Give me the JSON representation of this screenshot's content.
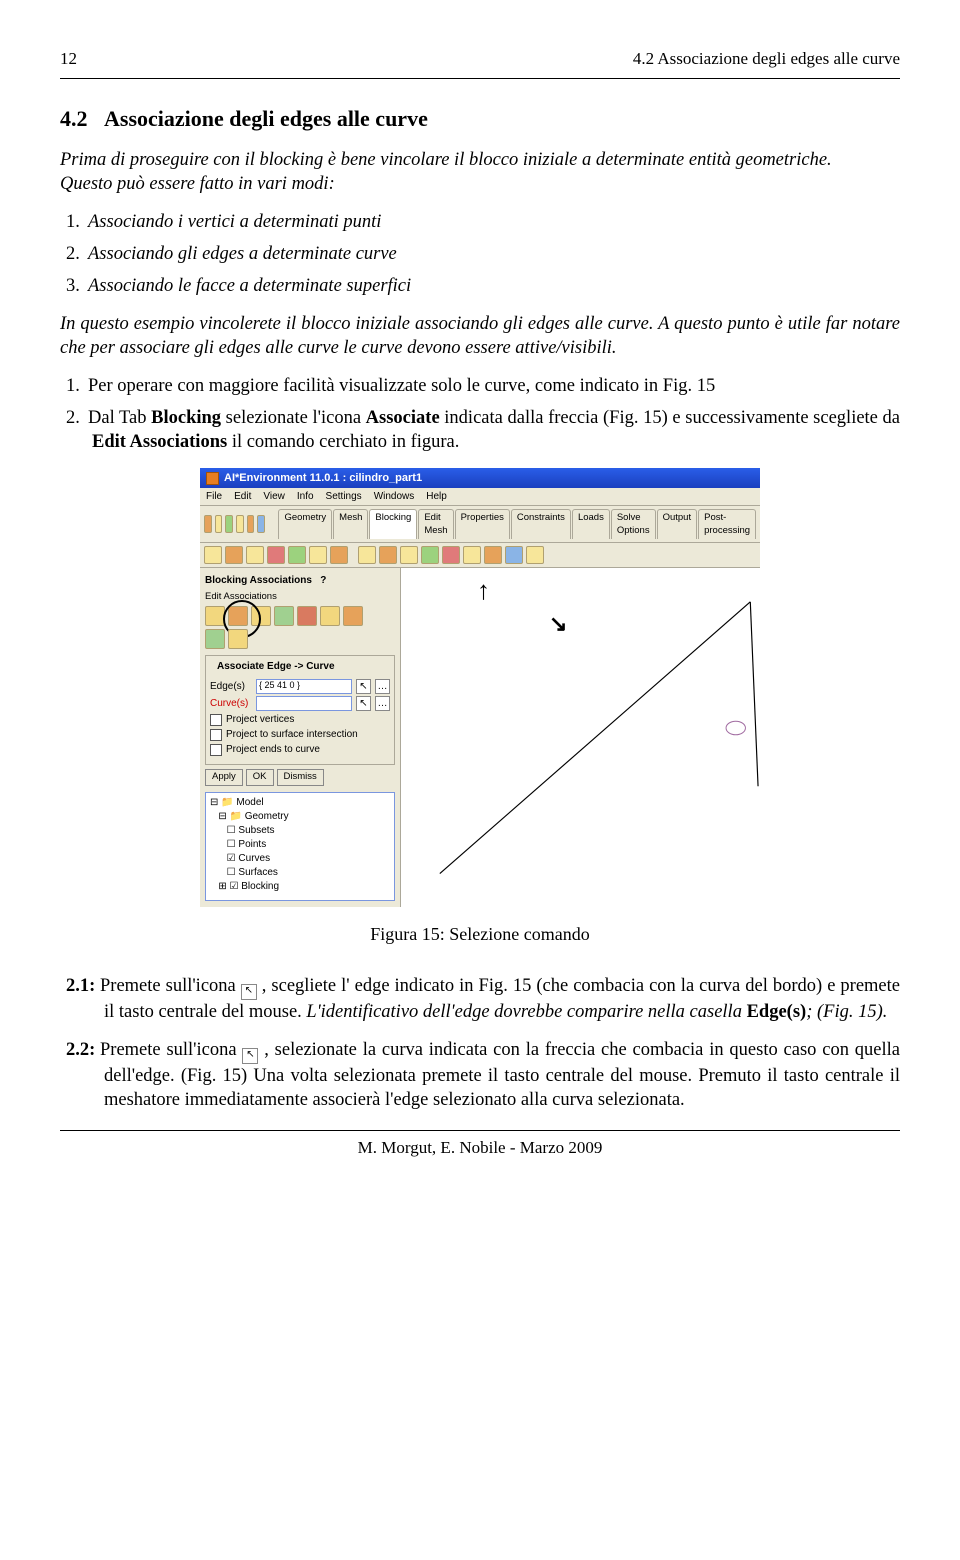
{
  "header": {
    "page": "12",
    "section_label": "4.2   Associazione degli edges alle curve"
  },
  "section": {
    "number": "4.2",
    "title": "Associazione degli edges alle curve"
  },
  "intro": {
    "p1_a": " Prima di proseguire con il blocking è bene vincolare il blocco iniziale a determinate entità geometriche.",
    "p1_b": "Questo può essere fatto in vari modi:"
  },
  "list_methods": {
    "i1": "Associando i vertici a determinati punti",
    "i2": "Associando gli edges a determinate curve",
    "i3": "Associando le facce a determinate superfici"
  },
  "para_after": "In questo esempio vincolerete il blocco iniziale associando gli edges alle curve. A questo punto è utile far notare che per associare gli edges alle curve le curve devono essere attive/visibili.",
  "steps": {
    "s1": "Per operare con maggiore facilità visualizzate solo le curve, come indicato in Fig. 15",
    "s2_a": "Dal Tab ",
    "s2_b": "Blocking",
    "s2_c": " selezionate l'icona ",
    "s2_d": "Associate",
    "s2_e": " indicata dalla freccia (Fig. 15) e successivamente scegliete da ",
    "s2_f": "Edit Associations",
    "s2_g": " il comando cerchiato in figura."
  },
  "fig_caption": "Figura 15: Selezione comando",
  "sub": {
    "a_n": "2.1:",
    "a_1": "Premete sull'icona ",
    "a_2": " , scegliete l' edge indicato in Fig. 15 (che combacia con la curva del bordo) e premete il tasto centrale del mouse. ",
    "a_3": "L'identificativo dell'edge dovrebbe comparire nella casella ",
    "a_4": "Edge(s)",
    "a_5": "; (Fig. 15).",
    "b_n": "2.2:",
    "b_1": "Premete sull'icona ",
    "b_2": " , selezionate la curva indicata con la freccia che combacia in questo caso con quella dell'edge. (Fig. 15) Una volta selezionata premete il tasto centrale del mouse. Premuto il tasto centrale il meshatore immediatamente associerà l'edge selezionato alla curva selezionata."
  },
  "footer": "M. Morgut, E. Nobile - Marzo 2009",
  "fig": {
    "title": "AI*Environment 11.0.1 : cilindro_part1",
    "menus": [
      "File",
      "Edit",
      "View",
      "Info",
      "Settings",
      "Windows",
      "Help"
    ],
    "tabs": [
      "Geometry",
      "Mesh",
      "Blocking",
      "Edit Mesh",
      "Properties",
      "Constraints",
      "Loads",
      "Solve Options",
      "Output",
      "Post-processing"
    ],
    "panel_head": "Blocking Associations",
    "edit_head": "Edit Associations",
    "group": "Associate Edge -> Curve",
    "edge_lbl": "Edge(s)",
    "edge_val": "{ 25 41 0 }",
    "curve_lbl": "Curve(s)",
    "c1": "Project vertices",
    "c2": "Project to surface intersection",
    "c3": "Project ends to curve",
    "btns": [
      "Apply",
      "OK",
      "Dismiss"
    ],
    "tree": [
      "⊟ 📁 Model",
      "   ⊟ 📁 Geometry",
      "      ☐ Subsets",
      "      ☐ Points",
      "      ☑ Curves",
      "      ☐ Surfaces",
      "   ⊞ ☑ Blocking"
    ]
  }
}
